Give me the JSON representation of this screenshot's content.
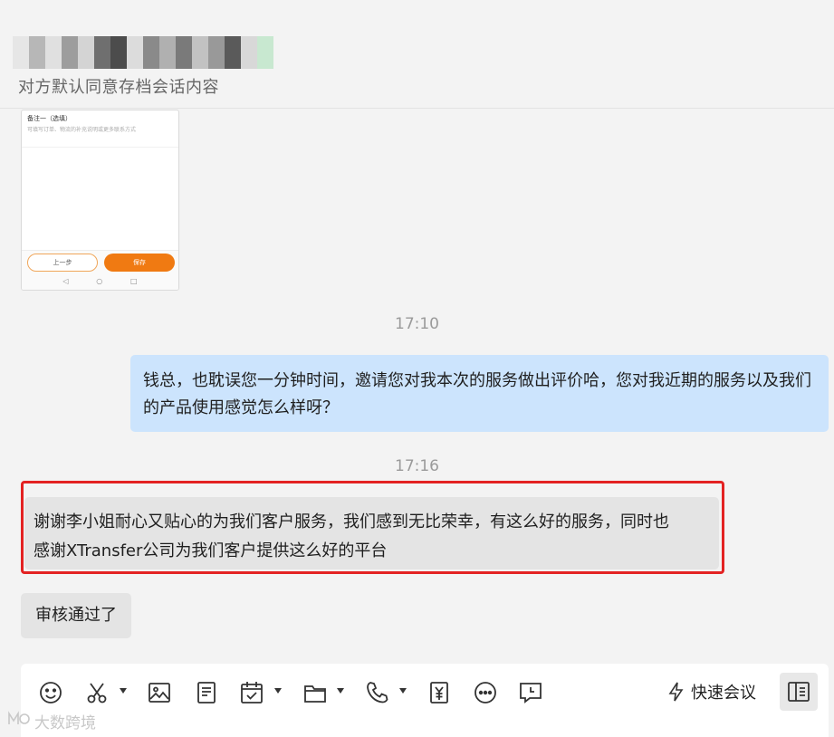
{
  "header": {
    "subtitle": "对方默认同意存档会话内容",
    "blur_colors": [
      "#e6e6e6",
      "#b7b7b7",
      "#e0e0e0",
      "#9d9d9d",
      "#d4d4d4",
      "#6f6f6f",
      "#4c4c4c",
      "#dcdcdc",
      "#8a8a8a",
      "#b0b0b0",
      "#7a7a7a",
      "#c2c2c2",
      "#999999",
      "#5a5a5a",
      "#d8d8d8",
      "#c8e8d0"
    ]
  },
  "screenshot_card": {
    "note_title": "备注一（选填）",
    "note_placeholder": "可填写订单、物流的补充说明或更多联系方式",
    "prev_button": "上一步",
    "save_button": "保存",
    "nav_back": "◁",
    "nav_home": "○",
    "nav_recent": "□"
  },
  "messages": {
    "time1": "17:10",
    "outgoing_text": "钱总，也耽误您一分钟时间，邀请您对我本次的服务做出评价哈，您对我近期的服务以及我们的产品使用感觉怎么样呀？",
    "time2": "17:16",
    "incoming_text_line1": "谢谢李小姐耐心又贴心的为我们客户服务，我们感到无比荣幸，有这么好的服务，同时也",
    "incoming_text_line2": "感谢XTransfer公司为我们客户提供这么好的平台",
    "incoming_text2": "审核通过了"
  },
  "toolbar": {
    "quick_meeting_label": "快速会议",
    "icons": [
      "emoji-icon",
      "scissors-icon",
      "image-icon",
      "document-icon",
      "calendar-check-icon",
      "folder-icon",
      "phone-icon",
      "yuan-icon",
      "more-icon",
      "comment-clock-icon"
    ]
  },
  "watermark": {
    "text": "大数跨境"
  },
  "colors": {
    "outgoing_bubble": "#cce4fd",
    "incoming_bubble": "#e4e4e4",
    "highlight": "#e32222",
    "save_orange": "#f07a12"
  }
}
